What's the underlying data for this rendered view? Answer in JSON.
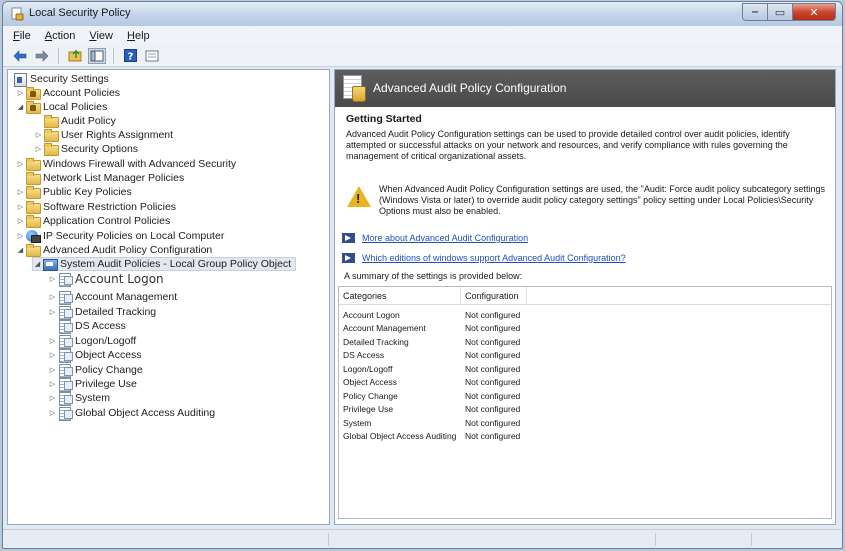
{
  "window": {
    "title": "Local Security Policy",
    "buttons": {
      "minimize": "‒",
      "maximize": "▭",
      "close": "✕"
    }
  },
  "menu": [
    {
      "label": "File",
      "key": "F",
      "rest": "ile"
    },
    {
      "label": "Action",
      "key": "A",
      "rest": "ction"
    },
    {
      "label": "View",
      "key": "V",
      "rest": "iew"
    },
    {
      "label": "Help",
      "key": "H",
      "rest": "elp"
    }
  ],
  "toolbar": {
    "icons": [
      "back-arrow-icon",
      "forward-arrow-icon",
      "up-folder-icon",
      "show-hide-tree-icon",
      "help-icon",
      "properties-icon"
    ]
  },
  "tree": {
    "root": "Security Settings",
    "items": [
      {
        "label": "Account Policies"
      },
      {
        "label": "Local Policies"
      },
      {
        "label": "Audit Policy"
      },
      {
        "label": "User Rights Assignment"
      },
      {
        "label": "Security Options"
      },
      {
        "label": "Windows Firewall with Advanced Security"
      },
      {
        "label": "Network List Manager Policies"
      },
      {
        "label": "Public Key Policies"
      },
      {
        "label": "Software Restriction Policies"
      },
      {
        "label": "Application Control Policies"
      },
      {
        "label": "IP Security Policies on Local Computer"
      },
      {
        "label": "Advanced Audit Policy Configuration"
      },
      {
        "label": "System Audit Policies - Local Group Policy Object"
      },
      {
        "label": "Account Logon"
      },
      {
        "label": "Account Management"
      },
      {
        "label": "Detailed Tracking"
      },
      {
        "label": "DS Access"
      },
      {
        "label": "Logon/Logoff"
      },
      {
        "label": "Object Access"
      },
      {
        "label": "Policy Change"
      },
      {
        "label": "Privilege Use"
      },
      {
        "label": "System"
      },
      {
        "label": "Global Object Access Auditing"
      }
    ]
  },
  "details": {
    "header_title": "Advanced Audit Policy Configuration",
    "subheading": "Getting Started",
    "intro": "Advanced Audit Policy Configuration settings can be used to provide detailed control over audit policies, identify attempted or successful attacks on your network and resources, and verify compliance with rules governing the management of critical organizational assets.",
    "warning": "When Advanced Audit Policy Configuration settings are used, the \"Audit: Force audit policy subcategory settings (Windows Vista or later) to override audit policy category settings\" policy setting under Local Policies\\Security Options must also be enabled.",
    "link1": "More about Advanced Audit Configuration",
    "link2": "Which editions of windows support Advanced Audit Configuration?",
    "summary": "A summary of the settings is provided below:",
    "columns": [
      "Categories",
      "Configuration"
    ],
    "rows": [
      {
        "category": "Account Logon",
        "config": "Not configured"
      },
      {
        "category": "Account Management",
        "config": "Not configured"
      },
      {
        "category": "Detailed Tracking",
        "config": "Not configured"
      },
      {
        "category": "DS Access",
        "config": "Not configured"
      },
      {
        "category": "Logon/Logoff",
        "config": "Not configured"
      },
      {
        "category": "Object Access",
        "config": "Not configured"
      },
      {
        "category": "Policy Change",
        "config": "Not configured"
      },
      {
        "category": "Privilege Use",
        "config": "Not configured"
      },
      {
        "category": "System",
        "config": "Not configured"
      },
      {
        "category": "Global Object Access Auditing",
        "config": "Not configured"
      }
    ]
  }
}
